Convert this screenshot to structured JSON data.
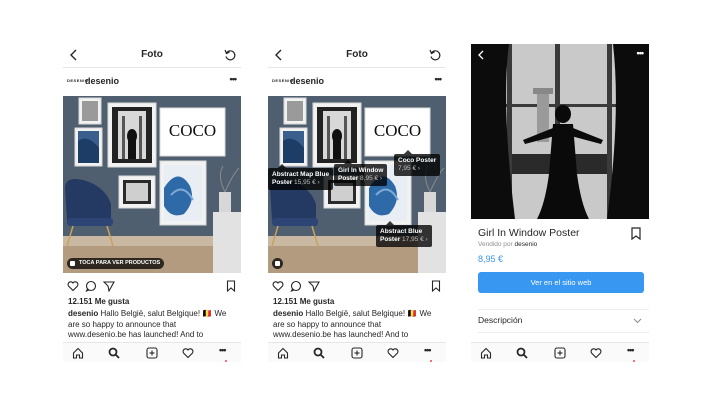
{
  "screens": [
    {
      "header_title": "Foto",
      "account_logo": "DESENIO",
      "account_name": "desenio",
      "more": "•••",
      "shop_pill": "TOCA PARA VER PRODUCTOS",
      "likes": "12.151 Me gusta",
      "caption_user": "desenio",
      "caption_text": " Hallo België, salut Belgique! 🇧🇪 We are so happy to announce that www.desenio.be has launched! And to celebrate this, you can",
      "print_text": "COCO"
    },
    {
      "header_title": "Foto",
      "account_logo": "DESENIO",
      "account_name": "desenio",
      "more": "•••",
      "likes": "12.151 Me gusta",
      "caption_user": "desenio",
      "caption_text": " Hallo België, salut Belgique! 🇧🇪 We are so happy to announce that www.desenio.be has launched! And to celebrate this, you can",
      "print_text": "COCO",
      "product_tags": [
        {
          "name_1": "Girl In Window",
          "name_2": "Poster",
          "price": "8,95 € ›"
        },
        {
          "name_1": "Coco Poster",
          "name_2": "",
          "price": "7,95 € ›"
        },
        {
          "name_1": "Abstract Map Blue",
          "name_2": "Poster",
          "price": "15,95 € ›"
        },
        {
          "name_1": "Abstract Blue",
          "name_2": "Poster",
          "price": "17,95 € ›"
        }
      ]
    },
    {
      "more": "•••",
      "product_title": "Girl In Window Poster",
      "vendor_prefix": "Vendido por ",
      "vendor_name": "desenio",
      "price": "8,95 €",
      "button_label": "Ver en el sitio web",
      "description_label": "Descripción"
    }
  ],
  "colors": {
    "link_blue": "#3897f0",
    "wall": "#4f5f70",
    "text": "#262626",
    "muted": "#8e8e8e"
  },
  "icons": [
    "back-arrow-icon",
    "refresh-icon",
    "heart-icon",
    "comment-icon",
    "share-icon",
    "bookmark-icon",
    "home-icon",
    "search-icon",
    "add-icon",
    "activity-icon",
    "shopping-bag-icon",
    "chevron-down-icon"
  ]
}
